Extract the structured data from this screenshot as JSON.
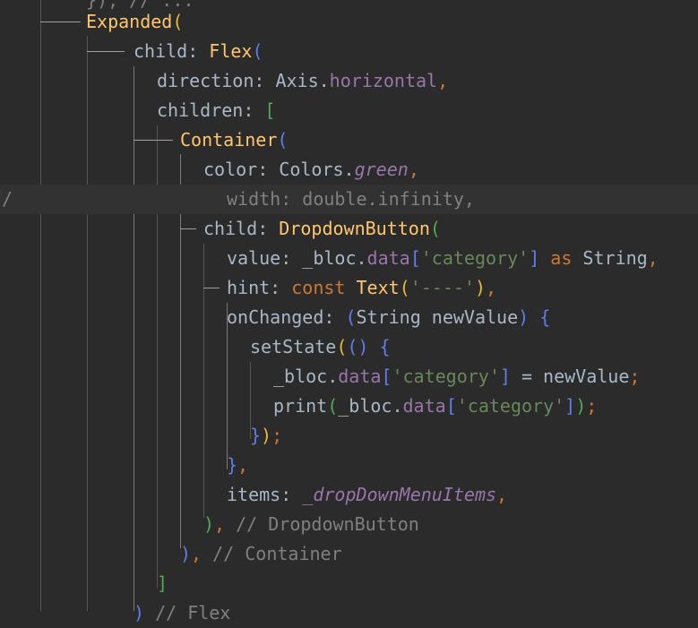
{
  "lines": [
    {
      "tokens": [
        {
          "t": "}), // ...",
          "c": "cmt"
        }
      ]
    },
    {
      "tokens": [
        {
          "t": "Expanded",
          "c": "cls"
        },
        {
          "t": "(",
          "c": "b1"
        }
      ]
    },
    {
      "tokens": [
        {
          "t": "child: ",
          "c": "pun"
        },
        {
          "t": "Flex",
          "c": "cls"
        },
        {
          "t": "(",
          "c": "b3"
        }
      ]
    },
    {
      "tokens": [
        {
          "t": "direction: ",
          "c": "pun"
        },
        {
          "t": "Axis.",
          "c": "pun"
        },
        {
          "t": "horizontal",
          "c": "prop"
        },
        {
          "t": ",",
          "c": "kw"
        }
      ]
    },
    {
      "tokens": [
        {
          "t": "children: ",
          "c": "pun"
        },
        {
          "t": "[",
          "c": "b2"
        }
      ]
    },
    {
      "tokens": [
        {
          "t": "Container",
          "c": "cls"
        },
        {
          "t": "(",
          "c": "b3"
        }
      ]
    },
    {
      "tokens": [
        {
          "t": "color: ",
          "c": "pun"
        },
        {
          "t": "Colors.",
          "c": "pun"
        },
        {
          "t": "green",
          "c": "ital"
        },
        {
          "t": ",",
          "c": "kw"
        }
      ]
    },
    {
      "tokens": [
        {
          "t": "width: double.infinity,",
          "c": "cmt"
        }
      ]
    },
    {
      "tokens": [
        {
          "t": "child: ",
          "c": "pun"
        },
        {
          "t": "DropdownButton",
          "c": "cls"
        },
        {
          "t": "(",
          "c": "b2"
        }
      ]
    },
    {
      "tokens": [
        {
          "t": "value: ",
          "c": "pun"
        },
        {
          "t": "_bloc.",
          "c": "pun"
        },
        {
          "t": "data",
          "c": "prop"
        },
        {
          "t": "[",
          "c": "b3"
        },
        {
          "t": "'category'",
          "c": "str"
        },
        {
          "t": "]",
          "c": "b3"
        },
        {
          "t": " as ",
          "c": "kw"
        },
        {
          "t": "String",
          "c": "type"
        },
        {
          "t": ",",
          "c": "kw"
        }
      ]
    },
    {
      "tokens": [
        {
          "t": "hint: ",
          "c": "pun"
        },
        {
          "t": "const ",
          "c": "kw"
        },
        {
          "t": "Text",
          "c": "cls"
        },
        {
          "t": "(",
          "c": "b1"
        },
        {
          "t": "'----'",
          "c": "str"
        },
        {
          "t": ")",
          "c": "b1"
        },
        {
          "t": ",",
          "c": "kw"
        }
      ]
    },
    {
      "tokens": [
        {
          "t": "onChanged: ",
          "c": "pun"
        },
        {
          "t": "(",
          "c": "b3"
        },
        {
          "t": "String newValue",
          "c": "pun"
        },
        {
          "t": ")",
          "c": "b3"
        },
        {
          "t": " {",
          "c": "b3"
        }
      ]
    },
    {
      "tokens": [
        {
          "t": "setState",
          "c": "pun"
        },
        {
          "t": "(",
          "c": "b1"
        },
        {
          "t": "() {",
          "c": "b3"
        }
      ]
    },
    {
      "tokens": [
        {
          "t": "_bloc.",
          "c": "pun"
        },
        {
          "t": "data",
          "c": "prop"
        },
        {
          "t": "[",
          "c": "b3"
        },
        {
          "t": "'category'",
          "c": "str"
        },
        {
          "t": "]",
          "c": "b3"
        },
        {
          "t": " = newValue",
          "c": "pun"
        },
        {
          "t": ";",
          "c": "kw"
        }
      ]
    },
    {
      "tokens": [
        {
          "t": "print",
          "c": "pun"
        },
        {
          "t": "(",
          "c": "b2"
        },
        {
          "t": "_bloc.",
          "c": "pun"
        },
        {
          "t": "data",
          "c": "prop"
        },
        {
          "t": "[",
          "c": "b3"
        },
        {
          "t": "'category'",
          "c": "str"
        },
        {
          "t": "]",
          "c": "b3"
        },
        {
          "t": ")",
          "c": "b2"
        },
        {
          "t": ";",
          "c": "kw"
        }
      ]
    },
    {
      "tokens": [
        {
          "t": "}",
          "c": "b3"
        },
        {
          "t": ")",
          "c": "b1"
        },
        {
          "t": ";",
          "c": "kw"
        }
      ]
    },
    {
      "tokens": [
        {
          "t": "}",
          "c": "b3"
        },
        {
          "t": ",",
          "c": "kw"
        }
      ]
    },
    {
      "tokens": [
        {
          "t": "items: ",
          "c": "pun"
        },
        {
          "t": "_dropDownMenuItems",
          "c": "ital"
        },
        {
          "t": ",",
          "c": "kw"
        }
      ]
    },
    {
      "tokens": [
        {
          "t": ")",
          "c": "b2"
        },
        {
          "t": ", ",
          "c": "kw"
        },
        {
          "t": "// DropdownButton",
          "c": "cmt"
        }
      ]
    },
    {
      "tokens": [
        {
          "t": ")",
          "c": "b3"
        },
        {
          "t": ", ",
          "c": "kw"
        },
        {
          "t": "// Container",
          "c": "cmt"
        }
      ]
    },
    {
      "tokens": [
        {
          "t": "]",
          "c": "b2"
        }
      ]
    },
    {
      "tokens": [
        {
          "t": ")",
          "c": "b3"
        },
        {
          "t": " // Flex",
          "c": "cmt"
        }
      ]
    }
  ],
  "gutter_mark": "//"
}
